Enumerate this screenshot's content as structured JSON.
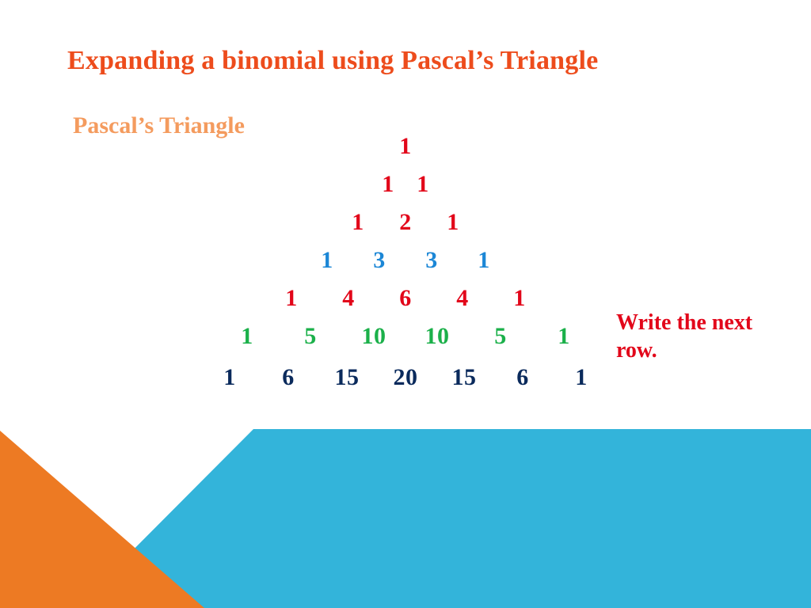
{
  "title": "Expanding a binomial using Pascal’s Triangle",
  "subtitle": "Pascal’s Triangle",
  "note": "Write the next row.",
  "triangle": {
    "rows": [
      {
        "values": [
          "1"
        ]
      },
      {
        "values": [
          "1",
          "1"
        ]
      },
      {
        "values": [
          "1",
          "2",
          "1"
        ]
      },
      {
        "values": [
          "1",
          "3",
          "3",
          "1"
        ]
      },
      {
        "values": [
          "1",
          "4",
          "6",
          "4",
          "1"
        ]
      },
      {
        "values": [
          "1",
          "5",
          "10",
          "10",
          "5",
          "1"
        ]
      },
      {
        "values": [
          "1",
          "6",
          "15",
          "20",
          "15",
          "6",
          "1"
        ]
      }
    ]
  },
  "colors": {
    "title": "#ed4c1c",
    "subtitle": "#f49b5e",
    "row0": "#e2061a",
    "row1": "#e2061a",
    "row2": "#e2061a",
    "row3": "#1c87d6",
    "row4": "#e2061a",
    "row5": "#1bb04a",
    "row6": "#0a2a5c",
    "footer_orange": "#ed7a23",
    "footer_dark": "#2399c4",
    "footer_light": "#33b4da"
  }
}
